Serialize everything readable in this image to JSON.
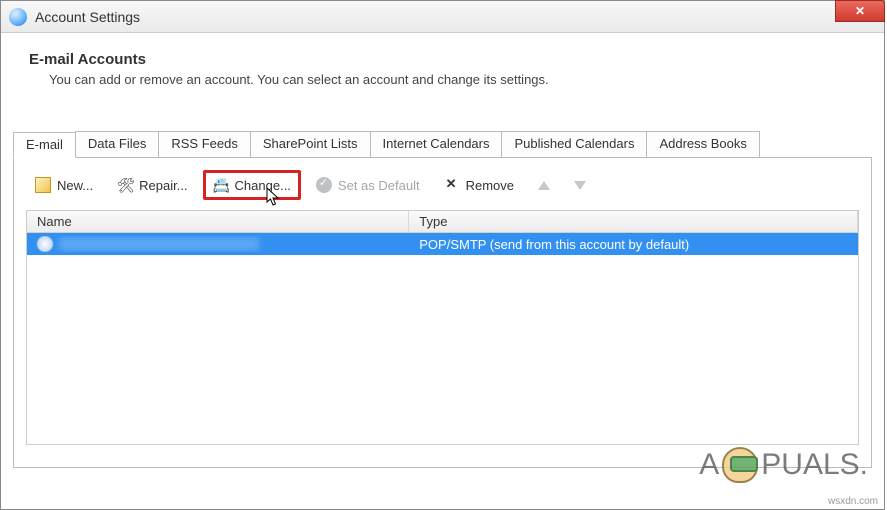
{
  "window": {
    "title": "Account Settings"
  },
  "header": {
    "heading": "E-mail Accounts",
    "subheading": "You can add or remove an account. You can select an account and change its settings."
  },
  "tabs": [
    {
      "label": "E-mail",
      "active": true
    },
    {
      "label": "Data Files",
      "active": false
    },
    {
      "label": "RSS Feeds",
      "active": false
    },
    {
      "label": "SharePoint Lists",
      "active": false
    },
    {
      "label": "Internet Calendars",
      "active": false
    },
    {
      "label": "Published Calendars",
      "active": false
    },
    {
      "label": "Address Books",
      "active": false
    }
  ],
  "toolbar": {
    "new_label": "New...",
    "repair_label": "Repair...",
    "change_label": "Change...",
    "set_default_label": "Set as Default",
    "remove_label": "Remove"
  },
  "list": {
    "columns": {
      "name": "Name",
      "type": "Type"
    },
    "rows": [
      {
        "name": "",
        "type": "POP/SMTP (send from this account by default)"
      }
    ]
  },
  "watermark": {
    "prefix": "A",
    "suffix": "PUALS."
  },
  "source_note": "wsxdn.com"
}
